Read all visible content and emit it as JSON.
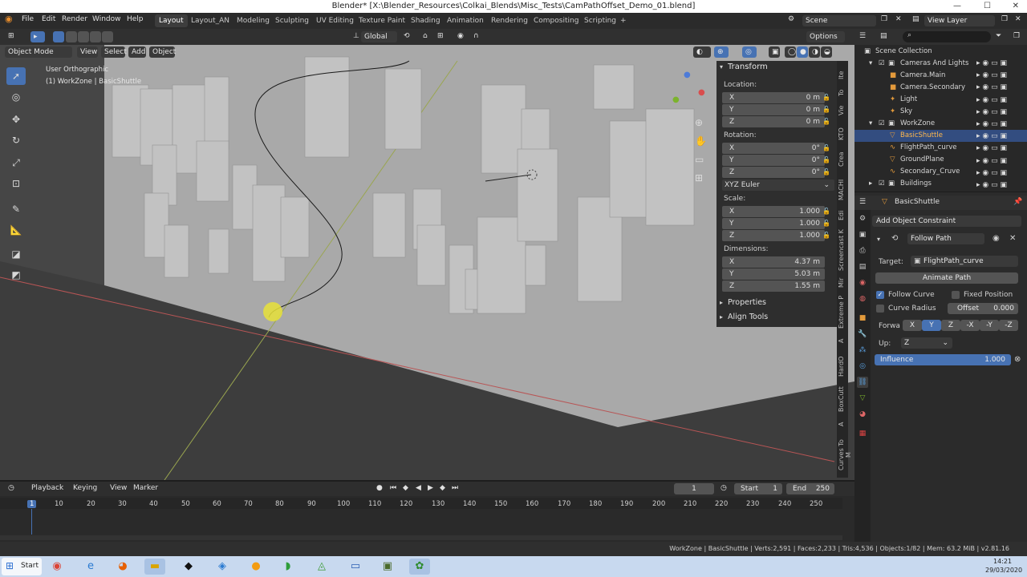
{
  "window": {
    "title": "Blender* [X:\\Blender_Resources\\Colkai_Blends\\Misc_Tests\\CamPathOffset_Demo_01.blend]"
  },
  "menu": [
    "File",
    "Edit",
    "Render",
    "Window",
    "Help"
  ],
  "workspaces": [
    "Layout",
    "Layout_AN",
    "Modeling",
    "Sculpting",
    "UV Editing",
    "Texture Paint",
    "Shading",
    "Animation",
    "Rendering",
    "Compositing",
    "Scripting",
    "+"
  ],
  "active_workspace": "Layout",
  "scene_name": "Scene",
  "view_layer": "View Layer",
  "viewport_header": {
    "mode": "Object Mode",
    "menus": [
      "View",
      "Select",
      "Add",
      "Object"
    ],
    "transform_orientation": "Global",
    "options": "Options"
  },
  "viewport_overlay": {
    "view_name": "User Orthographic",
    "collection_info": "(1) WorkZone | BasicShuttle"
  },
  "npanel": {
    "header": "Transform",
    "location_label": "Location:",
    "location": [
      {
        "axis": "X",
        "value": "0 m"
      },
      {
        "axis": "Y",
        "value": "0 m"
      },
      {
        "axis": "Z",
        "value": "0 m"
      }
    ],
    "rotation_label": "Rotation:",
    "rotation": [
      {
        "axis": "X",
        "value": "0°"
      },
      {
        "axis": "Y",
        "value": "0°"
      },
      {
        "axis": "Z",
        "value": "0°"
      }
    ],
    "rotation_mode": "XYZ Euler",
    "scale_label": "Scale:",
    "scale": [
      {
        "axis": "X",
        "value": "1.000"
      },
      {
        "axis": "Y",
        "value": "1.000"
      },
      {
        "axis": "Z",
        "value": "1.000"
      }
    ],
    "dimensions_label": "Dimensions:",
    "dimensions": [
      {
        "axis": "X",
        "value": "4.37 m"
      },
      {
        "axis": "Y",
        "value": "5.03 m"
      },
      {
        "axis": "Z",
        "value": "1.55 m"
      }
    ],
    "properties": "Properties",
    "align_tools": "Align Tools",
    "tabs": [
      "Ite",
      "To",
      "Vie",
      "KTO",
      "Crea",
      "MACHI",
      "Edi",
      "Screencast K",
      "Mir",
      "Extreme P",
      "A",
      "HardO",
      "BoxCutt",
      "A",
      "Curves To M"
    ]
  },
  "outliner": {
    "search_placeholder": "",
    "rows": [
      {
        "label": "Scene Collection"
      },
      {
        "label": "Cameras And Lights"
      },
      {
        "label": "Camera.Main"
      },
      {
        "label": "Camera.Secondary"
      },
      {
        "label": "Light"
      },
      {
        "label": "Sky"
      },
      {
        "label": "WorkZone"
      },
      {
        "label": "BasicShuttle"
      },
      {
        "label": "FlightPath_curve"
      },
      {
        "label": "GroundPlane"
      },
      {
        "label": "Secondary_Cruve"
      },
      {
        "label": "Buildings"
      }
    ]
  },
  "properties": {
    "object_name": "BasicShuttle",
    "add_constraint": "Add Object Constraint",
    "constraint_name": "Follow Path",
    "target_label": "Target:",
    "target_value": "FlightPath_curve",
    "animate_path": "Animate Path",
    "follow_curve": "Follow Curve",
    "fixed_position": "Fixed Position",
    "curve_radius": "Curve Radius",
    "offset_label": "Offset",
    "offset_value": "0.000",
    "forward_label": "Forwa",
    "forward_axes": [
      "X",
      "Y",
      "Z",
      "-X",
      "-Y",
      "-Z"
    ],
    "forward_selected": "Y",
    "up_label": "Up:",
    "up_value": "Z",
    "influence_label": "Influence",
    "influence_value": "1.000"
  },
  "timeline": {
    "menus": [
      "Playback",
      "Keying",
      "View",
      "Marker"
    ],
    "current_frame": "1",
    "start_label": "Start",
    "start_value": "1",
    "end_label": "End",
    "end_value": "250",
    "ruler_ticks": [
      "1",
      "10",
      "20",
      "30",
      "40",
      "50",
      "60",
      "70",
      "80",
      "90",
      "100",
      "110",
      "120",
      "130",
      "140",
      "150",
      "160",
      "170",
      "180",
      "190",
      "200",
      "210",
      "220",
      "230",
      "240",
      "250"
    ]
  },
  "status_bar": {
    "text": "WorkZone | BasicShuttle | Verts:2,591 | Faces:2,233 | Tris:4,536 | Objects:1/82 | Mem: 63.2 MiB | v2.81.16"
  },
  "taskbar": {
    "start_label": "Start",
    "time": "14:21",
    "date": "29/03/2020"
  },
  "colors": {
    "accent": "#4772b3",
    "selected_row": "#334d80",
    "orange_object": "#e39a3b"
  }
}
